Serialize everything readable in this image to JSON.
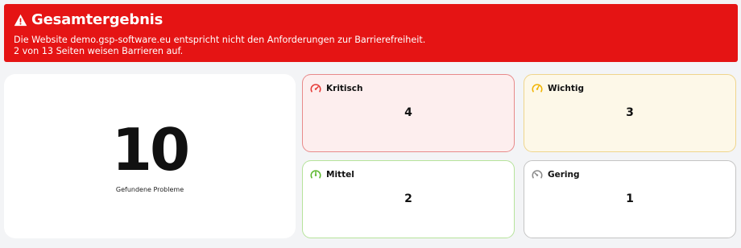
{
  "result": {
    "title": "Gesamtergebnis",
    "line1": "Die Website demo.gsp-software.eu entspricht nicht den Anforderungen zur Barrierefreiheit.",
    "line2": "2 von 13 Seiten weisen Barrieren auf.",
    "color": "#e51414"
  },
  "total": {
    "value": "10",
    "label": "Gefundene Probleme"
  },
  "severities": [
    {
      "label": "Kritisch",
      "count": "4",
      "icon": "gauge-critical-icon",
      "color": "#e53935"
    },
    {
      "label": "Wichtig",
      "count": "3",
      "icon": "gauge-important-icon",
      "color": "#f0b400"
    },
    {
      "label": "Mittel",
      "count": "2",
      "icon": "gauge-medium-icon",
      "color": "#5cb82e"
    },
    {
      "label": "Gering",
      "count": "1",
      "icon": "gauge-low-icon",
      "color": "#8a8a8a"
    }
  ]
}
